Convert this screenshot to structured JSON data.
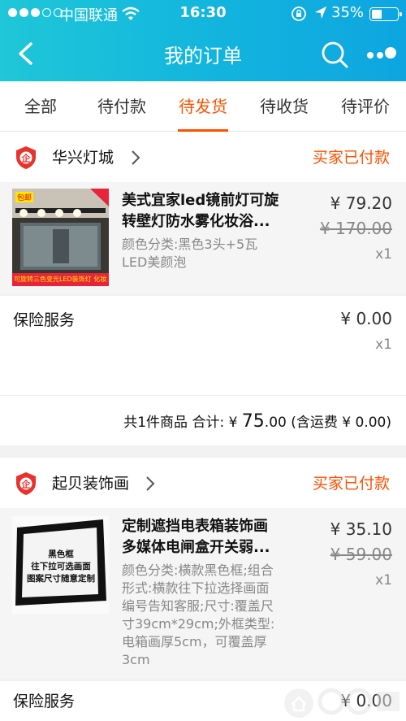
{
  "status_bar": {
    "carrier": "中国联通",
    "time": "16:30",
    "battery": "35%"
  },
  "nav": {
    "title": "我的订单"
  },
  "tabs": [
    "全部",
    "待付款",
    "待发货",
    "待收货",
    "待评价"
  ],
  "orders": [
    {
      "shop_name": "华兴灯城",
      "status": "买家已付款",
      "item": {
        "title_line1": "美式宜家led镜前灯可旋",
        "title_line2": "转壁灯防水雾化妆浴...",
        "sku_lines": [
          "颜色分类:黑色3头+5瓦",
          "LED美颜泡"
        ],
        "price": "¥ 79.20",
        "original_price": "¥ 170.00",
        "quantity": "x1",
        "thumb_text": {
          "badge": "包邮",
          "banner": "可旋转三色变光LED装饰灯 化妆镜灯"
        }
      },
      "insurance": {
        "label": "保险服务",
        "price": "¥ 0.00",
        "quantity": "x1"
      },
      "summary": {
        "prefix": "共1件商品 合计: ¥ ",
        "amount_int": "75",
        "amount_dec": ".00",
        "shipping": " (含运费 ¥ 0.00)"
      }
    },
    {
      "shop_name": "起贝装饰画",
      "status": "买家已付款",
      "item": {
        "title_line1": "定制遮挡电表箱装饰画",
        "title_line2": "多媒体电闸盒开关弱...",
        "sku_lines": [
          "颜色分类:横款黑色框;组合",
          "形式:横款往下拉选择画面",
          "编号告知客服;尺寸:覆盖尺",
          "寸39cm*29cm;外框类型:",
          "电箱画厚5cm，可覆盖厚",
          "3cm"
        ],
        "price": "¥ 35.10",
        "original_price": "¥ 59.00",
        "quantity": "x1",
        "thumb_text": {
          "line1": "黑色框",
          "line2": "往下拉可选画面",
          "line3": "图案尺寸随意定制"
        }
      },
      "insurance": {
        "label": "保险服务",
        "price": "¥ 0.00"
      }
    }
  ],
  "colors": {
    "accent": "#ff5000",
    "header_start": "#1fc7d8",
    "header_end": "#0ea5e0"
  }
}
